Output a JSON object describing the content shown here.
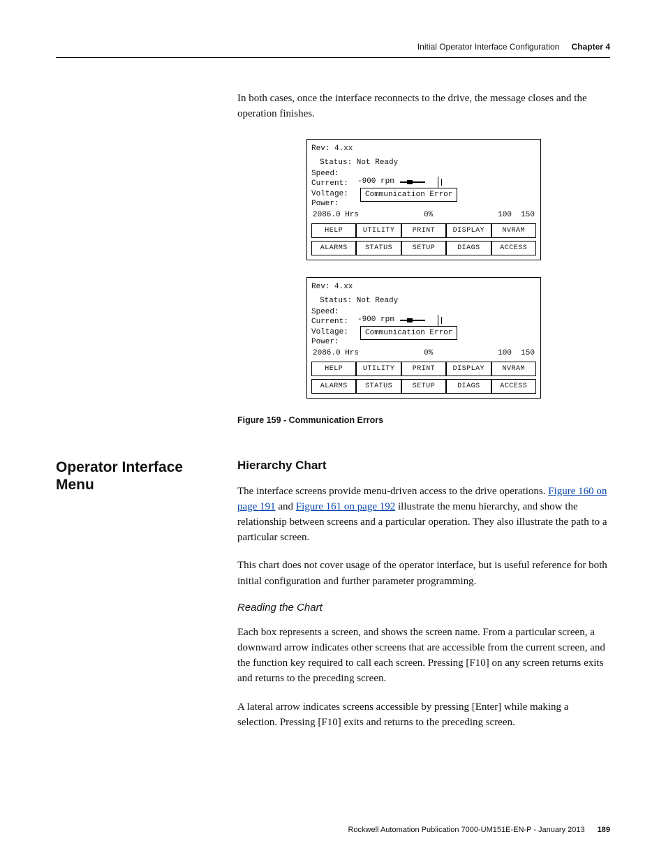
{
  "runningHead": {
    "section": "Initial Operator Interface Configuration",
    "chapter": "Chapter 4"
  },
  "introText": "In both cases, once the interface reconnects to the drive, the message closes and the operation finishes.",
  "lcd": {
    "rev": "Rev: 4.xx",
    "status": "Status: Not Ready",
    "labels": {
      "speed": "Speed:",
      "current": "Current:",
      "voltage": "Voltage:",
      "power": "Power:"
    },
    "speedVal": "-900 rpm",
    "commMsg": "Communication Error",
    "hrs": "2086.0 Hrs",
    "pct": "0%",
    "scale1": "100",
    "scale2": "150",
    "keys1": [
      "HELP",
      "UTILITY",
      "PRINT",
      "DISPLAY",
      "NVRAM"
    ],
    "keys2": [
      "ALARMS",
      "STATUS",
      "SETUP",
      "DIAGS",
      "ACCESS"
    ]
  },
  "figCaption": "Figure 159 - Communication Errors",
  "sideHeading": "Operator Interface Menu",
  "h2": "Hierarchy Chart",
  "para1a": "The interface screens provide menu-driven access to the drive operations. ",
  "link1": "Figure 160 on page 191",
  "para1b": " and ",
  "link2": "Figure 161 on page 192",
  "para1c": " illustrate the menu hierarchy, and show the relationship between screens and a particular operation. They also illustrate the path to a particular screen.",
  "para2": "This chart does not cover usage of the operator interface, but is useful reference for both initial configuration and further parameter programming.",
  "subH": "Reading the Chart",
  "para3": "Each box represents a screen, and shows the screen name. From a particular screen, a downward arrow indicates other screens that are accessible from the current screen, and the function key required to call each screen. Pressing [F10] on any screen returns exits and returns to the preceding screen.",
  "para4": "A lateral arrow indicates screens accessible by pressing [Enter] while making a selection. Pressing [F10] exits and returns to the preceding screen.",
  "footer": {
    "pub": "Rockwell Automation Publication 7000-UM151E-EN-P - January 2013",
    "page": "189"
  }
}
